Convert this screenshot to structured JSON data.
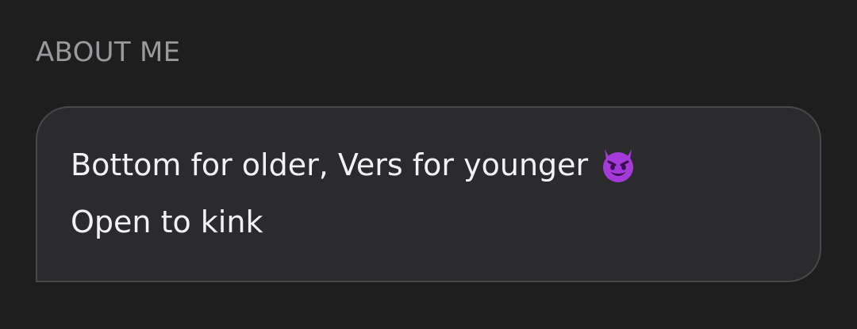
{
  "section": {
    "title": "ABOUT ME"
  },
  "bio": {
    "lines": [
      "Bottom for older, Vers for younger",
      "Open to kink"
    ],
    "emoji_icon": "smiling-devil-emoji"
  },
  "colors": {
    "background": "#1e1e1f",
    "card_background": "#2b2b2e",
    "card_border": "#48484c",
    "title_text": "#9a9a9e",
    "body_text": "#f2f2f4",
    "emoji_purple": "#a43bd8"
  }
}
